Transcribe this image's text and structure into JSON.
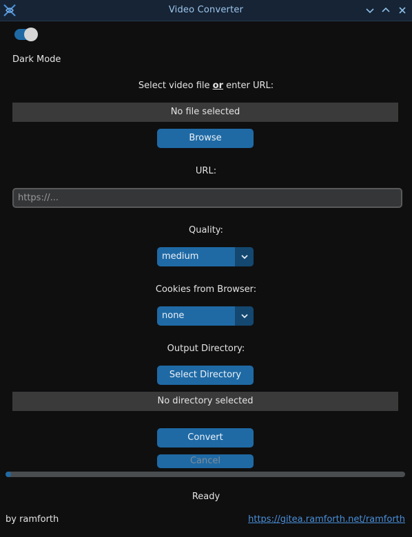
{
  "window": {
    "title": "Video Converter"
  },
  "theme": {
    "accent": "#1f6aa5",
    "dark_mode_on": true
  },
  "labels": {
    "dark_mode": "Dark Mode",
    "select_prefix": "Select video file ",
    "select_or": "or",
    "select_suffix": " enter URL:",
    "url": "URL:",
    "quality": "Quality:",
    "cookies": "Cookies from Browser:",
    "output_dir": "Output Directory:"
  },
  "file": {
    "status": "No file selected"
  },
  "buttons": {
    "browse": "Browse",
    "select_directory": "Select Directory",
    "convert": "Convert",
    "cancel": "Cancel"
  },
  "url_input": {
    "placeholder": "https://..."
  },
  "quality": {
    "selected": "medium"
  },
  "cookies": {
    "selected": "none"
  },
  "directory": {
    "status": "No directory selected"
  },
  "progress": {
    "value": 0.0
  },
  "status": "Ready",
  "footer": {
    "author": "by ramforth",
    "link": "https://gitea.ramforth.net/ramforth"
  }
}
